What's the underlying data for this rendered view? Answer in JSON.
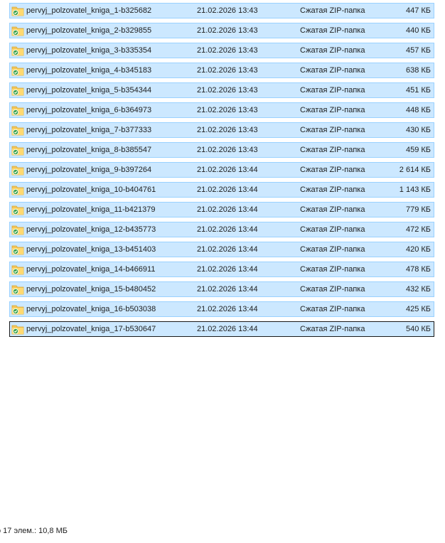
{
  "files": [
    {
      "name": "pervyj_polzovatel_kniga_1-b325682",
      "date": "21.02.2026 13:43",
      "type": "Сжатая ZIP-папка",
      "size": "447 КБ"
    },
    {
      "name": "pervyj_polzovatel_kniga_2-b329855",
      "date": "21.02.2026 13:43",
      "type": "Сжатая ZIP-папка",
      "size": "440 КБ"
    },
    {
      "name": "pervyj_polzovatel_kniga_3-b335354",
      "date": "21.02.2026 13:43",
      "type": "Сжатая ZIP-папка",
      "size": "457 КБ"
    },
    {
      "name": "pervyj_polzovatel_kniga_4-b345183",
      "date": "21.02.2026 13:43",
      "type": "Сжатая ZIP-папка",
      "size": "638 КБ"
    },
    {
      "name": "pervyj_polzovatel_kniga_5-b354344",
      "date": "21.02.2026 13:43",
      "type": "Сжатая ZIP-папка",
      "size": "451 КБ"
    },
    {
      "name": "pervyj_polzovatel_kniga_6-b364973",
      "date": "21.02.2026 13:43",
      "type": "Сжатая ZIP-папка",
      "size": "448 КБ"
    },
    {
      "name": "pervyj_polzovatel_kniga_7-b377333",
      "date": "21.02.2026 13:43",
      "type": "Сжатая ZIP-папка",
      "size": "430 КБ"
    },
    {
      "name": "pervyj_polzovatel_kniga_8-b385547",
      "date": "21.02.2026 13:43",
      "type": "Сжатая ZIP-папка",
      "size": "459 КБ"
    },
    {
      "name": "pervyj_polzovatel_kniga_9-b397264",
      "date": "21.02.2026 13:44",
      "type": "Сжатая ZIP-папка",
      "size": "2 614 КБ"
    },
    {
      "name": "pervyj_polzovatel_kniga_10-b404761",
      "date": "21.02.2026 13:44",
      "type": "Сжатая ZIP-папка",
      "size": "1 143 КБ"
    },
    {
      "name": "pervyj_polzovatel_kniga_11-b421379",
      "date": "21.02.2026 13:44",
      "type": "Сжатая ZIP-папка",
      "size": "779 КБ"
    },
    {
      "name": "pervyj_polzovatel_kniga_12-b435773",
      "date": "21.02.2026 13:44",
      "type": "Сжатая ZIP-папка",
      "size": "472 КБ"
    },
    {
      "name": "pervyj_polzovatel_kniga_13-b451403",
      "date": "21.02.2026 13:44",
      "type": "Сжатая ZIP-папка",
      "size": "420 КБ"
    },
    {
      "name": "pervyj_polzovatel_kniga_14-b466911",
      "date": "21.02.2026 13:44",
      "type": "Сжатая ZIP-папка",
      "size": "478 КБ"
    },
    {
      "name": "pervyj_polzovatel_kniga_15-b480452",
      "date": "21.02.2026 13:44",
      "type": "Сжатая ZIP-папка",
      "size": "432 КБ"
    },
    {
      "name": "pervyj_polzovatel_kniga_16-b503038",
      "date": "21.02.2026 13:44",
      "type": "Сжатая ZIP-папка",
      "size": "425 КБ"
    },
    {
      "name": "pervyj_polzovatel_kniga_17-b530647",
      "date": "21.02.2026 13:44",
      "type": "Сжатая ZIP-папка",
      "size": "540 КБ"
    }
  ],
  "file_icon": "zip-folder-icon",
  "selection_color": "#cce8ff",
  "selection_border_color": "#99d1ff",
  "status_bar": {
    "text": "о 17 элем.: 10,8 МБ"
  }
}
